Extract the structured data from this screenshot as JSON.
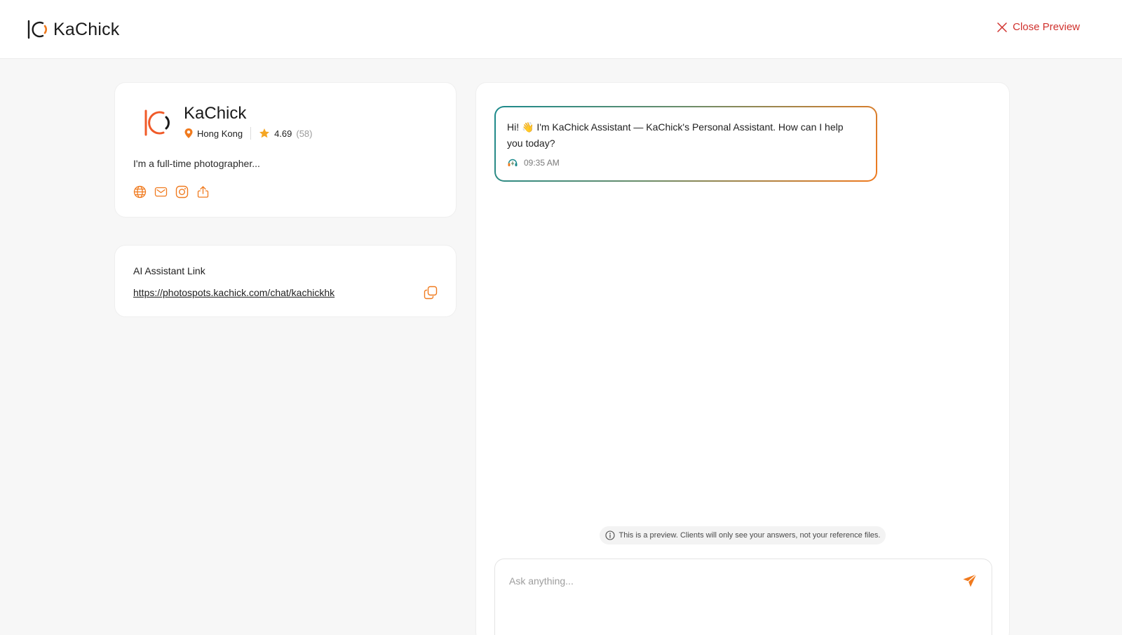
{
  "header": {
    "brand_name": "KaChick",
    "close_label": "Close Preview"
  },
  "profile": {
    "name": "KaChick",
    "location": "Hong Kong",
    "rating": "4.69",
    "rating_count": "(58)",
    "bio": "I'm a full-time photographer...",
    "social_icons": [
      "globe-icon",
      "mail-icon",
      "instagram-icon",
      "share-icon"
    ]
  },
  "assistant_link": {
    "title": "AI Assistant Link",
    "url": "https://photospots.kachick.com/chat/kachickhk"
  },
  "chat": {
    "messages": [
      {
        "text": "Hi! 👋 I'm KaChick Assistant — KaChick's Personal Assistant. How can I help you today?",
        "time": "09:35 AM"
      }
    ],
    "notice": "This is a preview. Clients will only see your answers, not your reference files.",
    "input_placeholder": "Ask anything..."
  },
  "colors": {
    "accent": "#f07a1e",
    "close": "#d0312d",
    "teal": "#1b8a8c"
  }
}
